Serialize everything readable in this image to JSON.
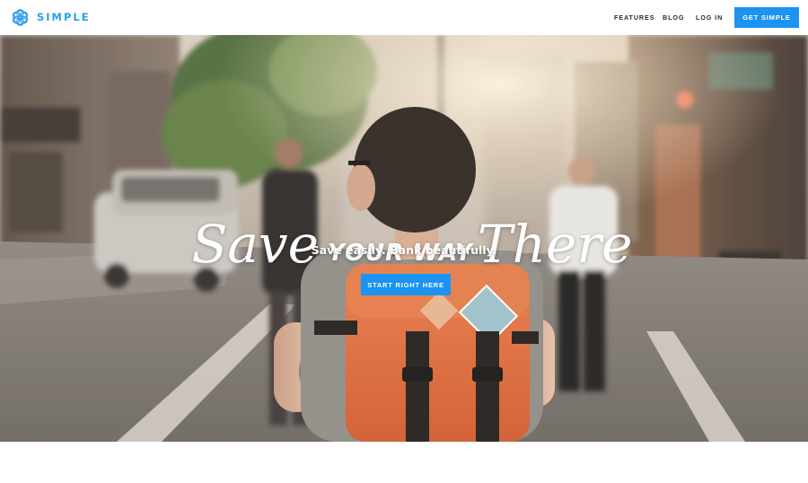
{
  "brand": {
    "name": "SIMPLE",
    "color": "#2a9fe8"
  },
  "nav": {
    "features": "FEATURES",
    "blog": "BLOG",
    "login": "LOG IN",
    "cta": "GET SIMPLE"
  },
  "hero": {
    "headline_script_1": "Save",
    "headline_caps": "YOUR WAY",
    "headline_script_2": "There",
    "subheadline": "Save easily. Bank beautifully.",
    "cta": "START RIGHT HERE"
  },
  "colors": {
    "accent": "#1b93f2",
    "nav_text": "#1f2a33",
    "backpack": "#e0683a"
  },
  "icons": {
    "logo": "simple-logo-icon"
  }
}
